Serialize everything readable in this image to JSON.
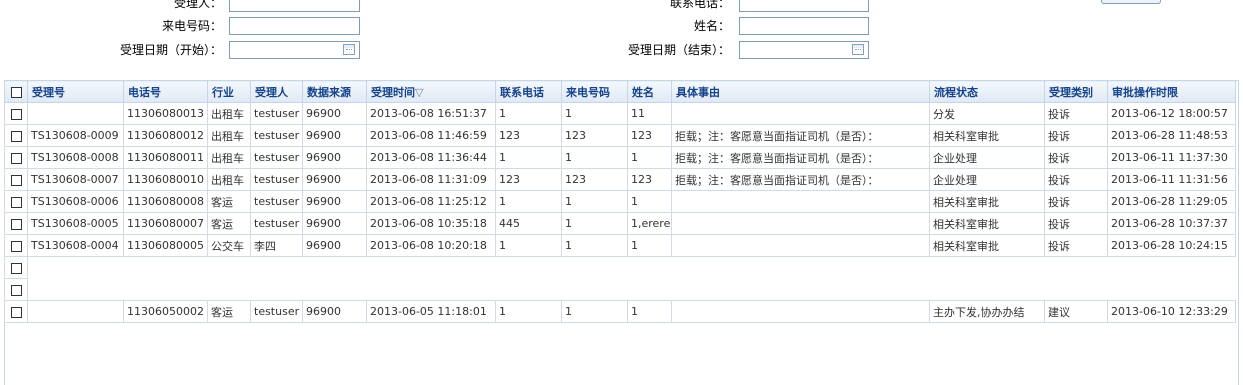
{
  "form": {
    "accept_person_label": "受理人：",
    "contact_phone_label": "联系电话：",
    "caller_number_label": "来电号码：",
    "name_label": "姓名：",
    "date_start_label": "受理日期（开始）：",
    "date_end_label": "受理日期（结束）：",
    "accept_person_value": "",
    "contact_phone_value": "",
    "caller_number_value": "",
    "name_value": "",
    "date_start_value": "",
    "date_end_value": ""
  },
  "table": {
    "headers": {
      "accept_no": "受理号",
      "phone": "电话号",
      "industry": "行业",
      "acceptor": "受理人",
      "source": "数据来源",
      "accept_time": "受理时间",
      "sort_mark": "▽",
      "contact_phone": "联系电话",
      "caller_no": "来电号码",
      "name": "姓名",
      "reason": "具体事由",
      "status": "流程状态",
      "category": "受理类别",
      "deadline": "审批操作时限"
    },
    "rows": [
      {
        "accept_no": "",
        "phone": "11306080013",
        "industry": "出租车",
        "acceptor": "testuser",
        "source": "96900",
        "accept_time": "2013-06-08 16:51:37",
        "contact_phone": "1",
        "caller_no": "1",
        "name": "11",
        "reason": "",
        "status": "分发",
        "category": "投诉",
        "deadline": "2013-06-12 18:00:57"
      },
      {
        "accept_no": "TS130608-0009",
        "phone": "11306080012",
        "industry": "出租车",
        "acceptor": "testuser",
        "source": "96900",
        "accept_time": "2013-06-08 11:46:59",
        "contact_phone": "123",
        "caller_no": "123",
        "name": "123",
        "reason": "拒载；注：客愿意当面指证司机（是否）：",
        "status": "相关科室审批",
        "category": "投诉",
        "deadline": "2013-06-28 11:48:53"
      },
      {
        "accept_no": "TS130608-0008",
        "phone": "11306080011",
        "industry": "出租车",
        "acceptor": "testuser",
        "source": "96900",
        "accept_time": "2013-06-08 11:36:44",
        "contact_phone": "1",
        "caller_no": "1",
        "name": "1",
        "reason": "拒载；注：客愿意当面指证司机（是否）：",
        "status": "企业处理",
        "category": "投诉",
        "deadline": "2013-06-11 11:37:30"
      },
      {
        "accept_no": "TS130608-0007",
        "phone": "11306080010",
        "industry": "出租车",
        "acceptor": "testuser",
        "source": "96900",
        "accept_time": "2013-06-08 11:31:09",
        "contact_phone": "123",
        "caller_no": "123",
        "name": "123",
        "reason": "拒载；注：客愿意当面指证司机（是否）：",
        "status": "企业处理",
        "category": "投诉",
        "deadline": "2013-06-11 11:31:56"
      },
      {
        "accept_no": "TS130608-0006",
        "phone": "11306080008",
        "industry": "客运",
        "acceptor": "testuser",
        "source": "96900",
        "accept_time": "2013-06-08 11:25:12",
        "contact_phone": "1",
        "caller_no": "1",
        "name": "1",
        "reason": "",
        "status": "相关科室审批",
        "category": "投诉",
        "deadline": "2013-06-28 11:29:05"
      },
      {
        "accept_no": "TS130608-0005",
        "phone": "11306080007",
        "industry": "客运",
        "acceptor": "testuser",
        "source": "96900",
        "accept_time": "2013-06-08 10:35:18",
        "contact_phone": "445",
        "caller_no": "1",
        "name": "1,erere",
        "reason": "",
        "status": "相关科室审批",
        "category": "投诉",
        "deadline": "2013-06-28 10:37:37"
      },
      {
        "accept_no": "TS130608-0004",
        "phone": "11306080005",
        "industry": "公交车",
        "acceptor": "李四",
        "source": "96900",
        "accept_time": "2013-06-08 10:20:18",
        "contact_phone": "1",
        "caller_no": "1",
        "name": "1",
        "reason": "",
        "status": "相关科室审批",
        "category": "投诉",
        "deadline": "2013-06-28 10:24:15"
      },
      {
        "blank": true
      },
      {
        "blank": true
      },
      {
        "accept_no": "",
        "phone": "11306050002",
        "industry": "客运",
        "acceptor": "testuser",
        "source": "96900",
        "accept_time": "2013-06-05 11:18:01",
        "contact_phone": "1",
        "caller_no": "1",
        "name": "1",
        "reason": "",
        "status": "主办下发,协办办结",
        "category": "建议",
        "deadline": "2013-06-10 12:33:29"
      }
    ]
  }
}
